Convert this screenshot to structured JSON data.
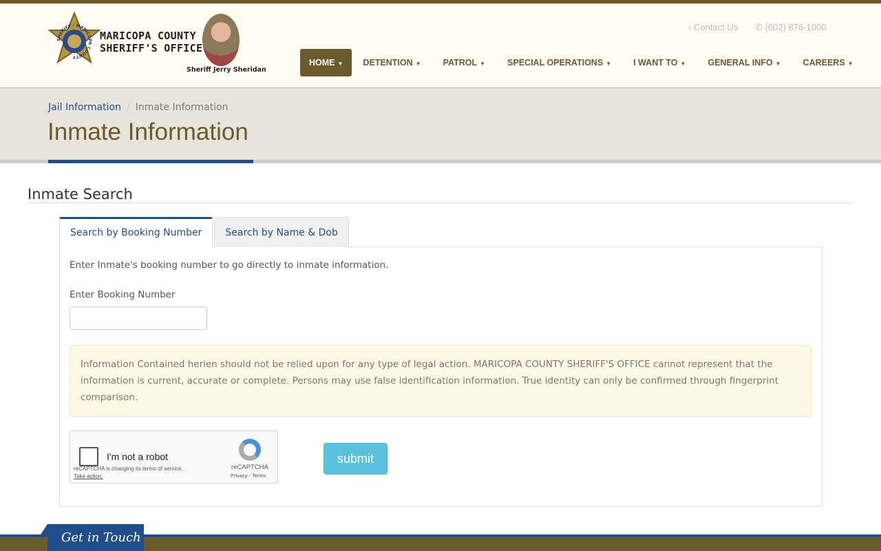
{
  "header": {
    "logo_line1": "MARICOPA COUNTY",
    "logo_line2": "SHERIFF'S OFFICE",
    "badge_text": "SHERIFF · MARICOPA COUNTY",
    "sheriff_caption": "Sheriff Jerry Sheridan",
    "contact_label": "Contact Us",
    "phone": "(602) 876-1000"
  },
  "nav": {
    "items": [
      {
        "label": "HOME"
      },
      {
        "label": "DETENTION"
      },
      {
        "label": "PATROL"
      },
      {
        "label": "SPECIAL OPERATIONS"
      },
      {
        "label": "I WANT TO"
      },
      {
        "label": "GENERAL INFO"
      },
      {
        "label": "CAREERS"
      }
    ],
    "active": "HOME"
  },
  "breadcrumb": {
    "parent": "Jail Information",
    "separator": "/",
    "current": "Inmate Information"
  },
  "page_title": "Inmate Information",
  "section_title": "Inmate Search",
  "tabs": [
    {
      "label": "Search by Booking Number",
      "active": true
    },
    {
      "label": "Search by Name & Dob",
      "active": false
    }
  ],
  "form": {
    "intro": "Enter Inmate's booking number to go directly to inmate information.",
    "booking_label": "Enter Booking Number",
    "booking_value": "",
    "disclaimer": "Information Contained herien should not be relied upon for any type of legal action. MARICOPA COUNTY SHERIFF'S OFFICE cannot represent that the information is current, accurate or complete. Persons may use false identification information. True identity can only be confirmed through fingerprint comparison.",
    "submit_label": "submit"
  },
  "captcha": {
    "label": "I'm not a robot",
    "terms_notice": "reCAPTCHA is changing its terms of service.",
    "take_action": "Take action.",
    "brand": "reCAPTCHA",
    "links": "Privacy - Terms"
  },
  "footer": {
    "get_in_touch": "Get in Touch"
  },
  "colors": {
    "brand_brown": "#6b5a2b",
    "brand_blue": "#1f4e8c",
    "submit": "#5bc0de",
    "alert_bg": "#fcf8e3"
  }
}
